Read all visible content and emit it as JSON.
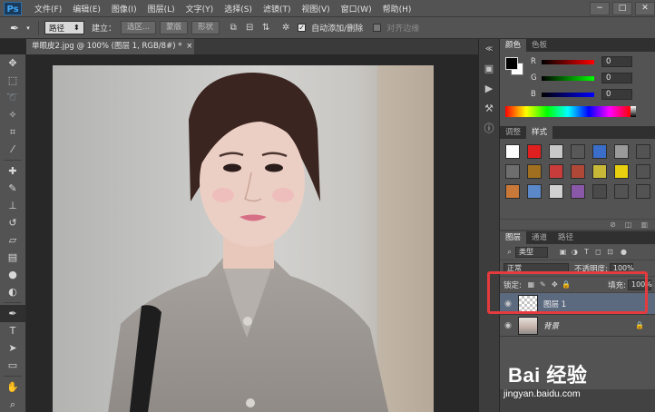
{
  "app": {
    "logo": "Ps"
  },
  "menu": [
    "文件(F)",
    "编辑(E)",
    "图像(I)",
    "图层(L)",
    "文字(Y)",
    "选择(S)",
    "滤镜(T)",
    "视图(V)",
    "窗口(W)",
    "帮助(H)"
  ],
  "window_controls": [
    "−",
    "□",
    "✕"
  ],
  "options": {
    "mode_value": "路径",
    "build_label": "建立：",
    "selection_btn": "选区...",
    "mask_btn": "蒙版",
    "shape_btn": "形状",
    "auto_add_delete": "自动添加/删除",
    "align_edges": "对齐边缘"
  },
  "document": {
    "tab_title": "单眼皮2.jpg @ 100% (图层 1, RGB/8#) *",
    "tab_close": "×"
  },
  "color_panel": {
    "tabs": [
      "颜色",
      "色板"
    ],
    "channels": [
      {
        "label": "R",
        "value": "0",
        "gradient_to": "#ff0000"
      },
      {
        "label": "G",
        "value": "0",
        "gradient_to": "#00ff00"
      },
      {
        "label": "B",
        "value": "0",
        "gradient_to": "#0000ff"
      }
    ],
    "foreground": "#000000",
    "background": "#ffffff"
  },
  "styles_panel": {
    "tabs": [
      "调整",
      "样式"
    ],
    "swatches": [
      "#ffffff",
      "#e02020",
      "#c8c8c8",
      "#585858",
      "#3a6ec8",
      "#9a9a9a",
      "#535353",
      "#6e6e6e",
      "#a07020",
      "#c83c3c",
      "#b04838",
      "#c8b838",
      "#e8d010",
      "#535353",
      "#c87838",
      "#5a88c8",
      "#d0d0d0",
      "#8a58a8",
      "#4a4a4a",
      "#535353",
      "#535353"
    ]
  },
  "layers_panel": {
    "tabs": [
      "图层",
      "通道",
      "路径"
    ],
    "kind_label": "类型",
    "blend_mode": "正常",
    "opacity_label": "不透明度:",
    "opacity_value": "100%",
    "lock_label": "锁定:",
    "fill_label": "填充:",
    "fill_value": "100%",
    "layers": [
      {
        "name": "图层 1",
        "selected": true,
        "locked": false,
        "thumb": "transparent"
      },
      {
        "name": "背景",
        "selected": false,
        "locked": true,
        "thumb": "photo"
      }
    ]
  },
  "watermark": {
    "logo": "Bai 经验",
    "sub": "jingyan.baidu.com"
  }
}
